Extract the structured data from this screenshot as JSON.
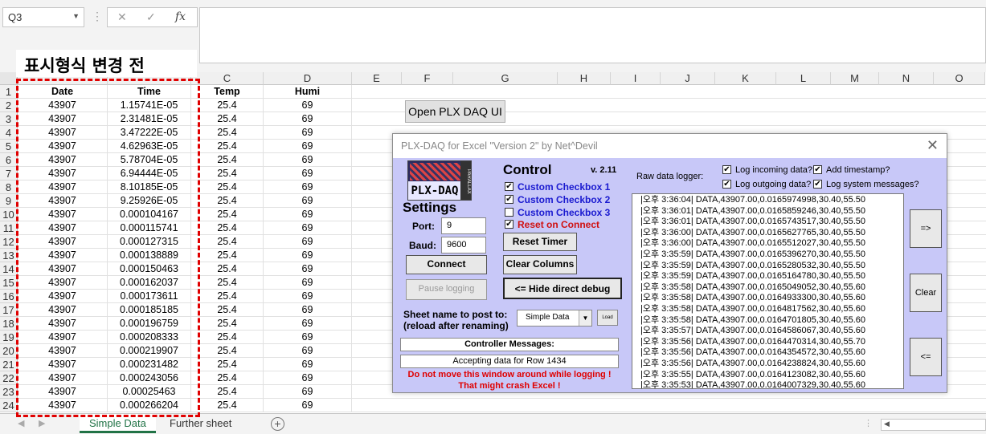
{
  "formula_bar": {
    "name_box": "Q3",
    "cancel": "✕",
    "enter": "✓",
    "fx": "fx",
    "formula": ""
  },
  "caption": "표시형식 변경 전",
  "columns": [
    "C",
    "D",
    "E",
    "F",
    "G",
    "H",
    "I",
    "J",
    "K",
    "L",
    "M",
    "N",
    "O"
  ],
  "header_row": {
    "row": "1",
    "date": "Date",
    "time": "Time",
    "temp": "Temp",
    "humi": "Humi"
  },
  "rows": [
    {
      "n": "2",
      "date": "43907",
      "time": "1.15741E-05",
      "temp": "25.4",
      "humi": "69"
    },
    {
      "n": "3",
      "date": "43907",
      "time": "2.31481E-05",
      "temp": "25.4",
      "humi": "69"
    },
    {
      "n": "4",
      "date": "43907",
      "time": "3.47222E-05",
      "temp": "25.4",
      "humi": "69"
    },
    {
      "n": "5",
      "date": "43907",
      "time": "4.62963E-05",
      "temp": "25.4",
      "humi": "69"
    },
    {
      "n": "6",
      "date": "43907",
      "time": "5.78704E-05",
      "temp": "25.4",
      "humi": "69"
    },
    {
      "n": "7",
      "date": "43907",
      "time": "6.94444E-05",
      "temp": "25.4",
      "humi": "69"
    },
    {
      "n": "8",
      "date": "43907",
      "time": "8.10185E-05",
      "temp": "25.4",
      "humi": "69"
    },
    {
      "n": "9",
      "date": "43907",
      "time": "9.25926E-05",
      "temp": "25.4",
      "humi": "69"
    },
    {
      "n": "10",
      "date": "43907",
      "time": "0.000104167",
      "temp": "25.4",
      "humi": "69"
    },
    {
      "n": "11",
      "date": "43907",
      "time": "0.000115741",
      "temp": "25.4",
      "humi": "69"
    },
    {
      "n": "12",
      "date": "43907",
      "time": "0.000127315",
      "temp": "25.4",
      "humi": "69"
    },
    {
      "n": "13",
      "date": "43907",
      "time": "0.000138889",
      "temp": "25.4",
      "humi": "69"
    },
    {
      "n": "14",
      "date": "43907",
      "time": "0.000150463",
      "temp": "25.4",
      "humi": "69"
    },
    {
      "n": "15",
      "date": "43907",
      "time": "0.000162037",
      "temp": "25.4",
      "humi": "69"
    },
    {
      "n": "16",
      "date": "43907",
      "time": "0.000173611",
      "temp": "25.4",
      "humi": "69"
    },
    {
      "n": "17",
      "date": "43907",
      "time": "0.000185185",
      "temp": "25.4",
      "humi": "69"
    },
    {
      "n": "18",
      "date": "43907",
      "time": "0.000196759",
      "temp": "25.4",
      "humi": "69"
    },
    {
      "n": "19",
      "date": "43907",
      "time": "0.000208333",
      "temp": "25.4",
      "humi": "69"
    },
    {
      "n": "20",
      "date": "43907",
      "time": "0.000219907",
      "temp": "25.4",
      "humi": "69"
    },
    {
      "n": "21",
      "date": "43907",
      "time": "0.000231482",
      "temp": "25.4",
      "humi": "69"
    },
    {
      "n": "22",
      "date": "43907",
      "time": "0.000243056",
      "temp": "25.4",
      "humi": "69"
    },
    {
      "n": "23",
      "date": "43907",
      "time": "0.00025463",
      "temp": "25.4",
      "humi": "69"
    },
    {
      "n": "24",
      "date": "43907",
      "time": "0.000266204",
      "temp": "25.4",
      "humi": "69"
    }
  ],
  "open_button": "Open PLX DAQ UI",
  "sheet_tabs": {
    "active": "Simple Data",
    "other": "Further sheet",
    "add": "+"
  },
  "dialog": {
    "title": "PLX-DAQ for Excel \"Version 2\" by Net^Devil",
    "close": "✕",
    "logo_text": "PLX-DAQ",
    "logo_side": "PARALLAX",
    "settings_heading": "Settings",
    "port_label": "Port:",
    "port_value": "9",
    "baud_label": "Baud:",
    "baud_value": "9600",
    "connect": "Connect",
    "pause": "Pause logging",
    "control_heading": "Control",
    "version": "v. 2.11",
    "checkboxes": [
      {
        "label": "Custom Checkbox 1",
        "checked": "✔"
      },
      {
        "label": "Custom Checkbox 2",
        "checked": "✔"
      },
      {
        "label": "Custom Checkbox 3",
        "checked": ""
      },
      {
        "label": "Reset on Connect",
        "checked": "✔"
      }
    ],
    "reset_timer": "Reset Timer",
    "clear_columns": "Clear Columns",
    "hide_debug": "<= Hide direct debug",
    "sheet_name_label1": "Sheet name to post to:",
    "sheet_name_label2": "(reload after renaming)",
    "sheet_select": "Simple Data",
    "load": "Load",
    "controller_messages": "Controller Messages:",
    "accepting": "Accepting data for Row 1434",
    "warning1": "Do not move this window around while logging !",
    "warning2": "That might crash Excel !",
    "raw_logger_label": "Raw data logger:",
    "log_options": [
      {
        "label": "Log incoming data?",
        "checked": "✔"
      },
      {
        "label": "Add timestamp?",
        "checked": "✔"
      },
      {
        "label": "Log outgoing data?",
        "checked": "✔"
      },
      {
        "label": "Log system messages?",
        "checked": "✔"
      }
    ],
    "log_lines": [
      "|오후 3:36:04| DATA,43907.00,0.0165974998,30.40,55.50",
      "|오후 3:36:01| DATA,43907.00,0.0165859246,30.40,55.50",
      "|오후 3:36:01| DATA,43907.00,0.0165743517,30.40,55.50",
      "|오후 3:36:00| DATA,43907.00,0.0165627765,30.40,55.50",
      "|오후 3:36:00| DATA,43907.00,0.0165512027,30.40,55.50",
      "|오후 3:35:59| DATA,43907.00,0.0165396270,30.40,55.50",
      "|오후 3:35:59| DATA,43907.00,0.0165280532,30.40,55.50",
      "|오후 3:35:59| DATA,43907.00,0.0165164780,30.40,55.50",
      "|오후 3:35:58| DATA,43907.00,0.0165049052,30.40,55.60",
      "|오후 3:35:58| DATA,43907.00,0.0164933300,30.40,55.60",
      "|오후 3:35:58| DATA,43907.00,0.0164817562,30.40,55.60",
      "|오후 3:35:58| DATA,43907.00,0.0164701805,30.40,55.60",
      "|오후 3:35:57| DATA,43907.00,0.0164586067,30.40,55.60",
      "|오후 3:35:56| DATA,43907.00,0.0164470314,30.40,55.70",
      "|오후 3:35:56| DATA,43907.00,0.0164354572,30.40,55.60",
      "|오후 3:35:56| DATA,43907.00,0.0164238824,30.40,55.60",
      "|오후 3:35:55| DATA,43907.00,0.0164123082,30.40,55.60",
      "|오후 3:35:53| DATA,43907.00,0.0164007329,30.40,55.60"
    ],
    "btn_right": "=>",
    "btn_clear": "Clear",
    "btn_left": "<="
  }
}
